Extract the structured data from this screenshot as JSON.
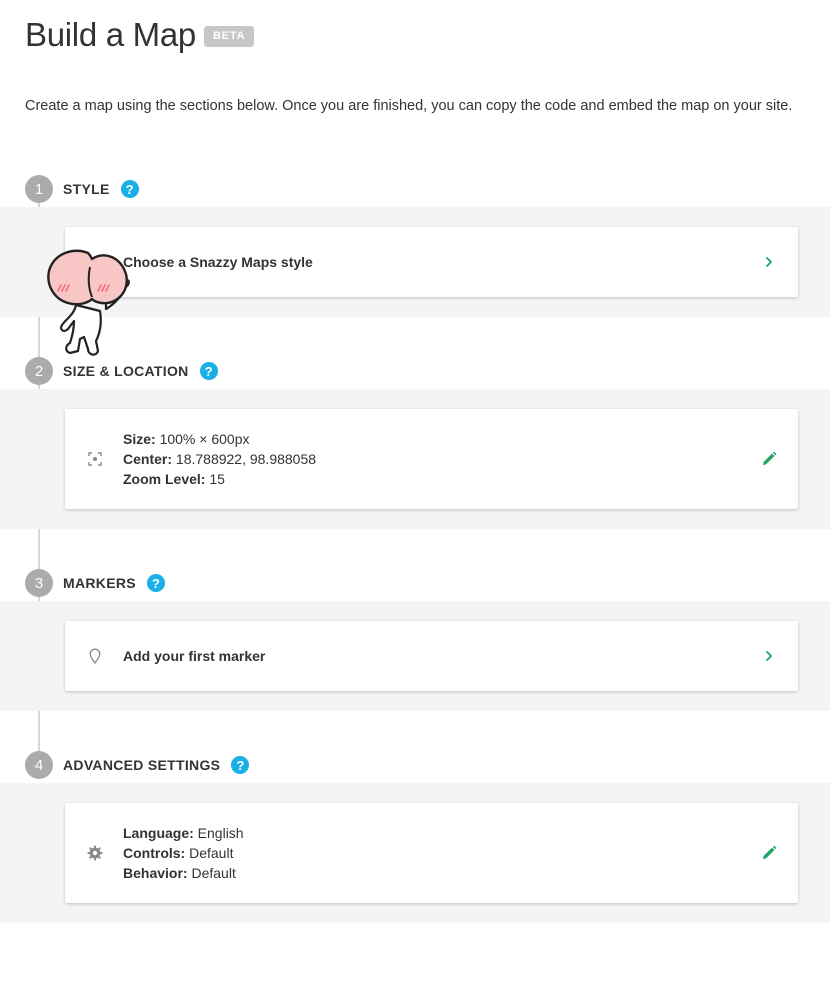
{
  "header": {
    "title": "Build a Map",
    "badge": "BETA"
  },
  "intro": "Create a map using the sections below. Once you are finished, you can copy the code and embed the map on your site.",
  "steps": [
    {
      "number": "1",
      "title": "STYLE",
      "help": "?",
      "card": {
        "label": "Choose a Snazzy Maps style"
      }
    },
    {
      "number": "2",
      "title": "SIZE & LOCATION",
      "help": "?",
      "card": {
        "icon": "focus-frame-icon",
        "fields": [
          {
            "key": "Size:",
            "value": "100% × 600px"
          },
          {
            "key": "Center:",
            "value": "18.788922, 98.988058"
          },
          {
            "key": "Zoom Level:",
            "value": "15"
          }
        ]
      }
    },
    {
      "number": "3",
      "title": "MARKERS",
      "help": "?",
      "card": {
        "icon": "map-pin-icon",
        "label": "Add your first marker"
      }
    },
    {
      "number": "4",
      "title": "ADVANCED SETTINGS",
      "help": "?",
      "card": {
        "icon": "gear-icon",
        "fields": [
          {
            "key": "Language:",
            "value": "English"
          },
          {
            "key": "Controls:",
            "value": "Default"
          },
          {
            "key": "Behavior:",
            "value": "Default"
          }
        ]
      }
    }
  ],
  "colors": {
    "accent_help": "#1aafe6",
    "action_green": "#1fa463",
    "step_circle": "#ababab",
    "band_bg": "#f4f4f4"
  }
}
